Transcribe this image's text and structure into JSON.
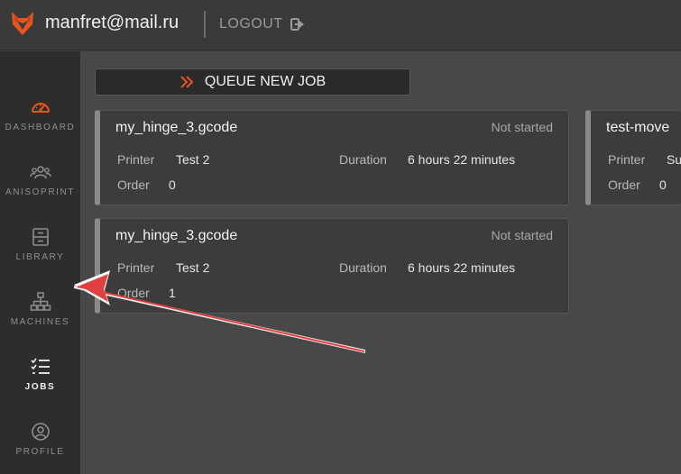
{
  "header": {
    "user": "manfret@mail.ru",
    "logout_label": "LOGOUT",
    "logo_icon": "fox-logo-icon",
    "accent_color": "#e8531f"
  },
  "sidebar": {
    "items": [
      {
        "label": "DASHBOARD",
        "icon": "speedometer-icon",
        "active": false
      },
      {
        "label": "ANISOPRINT",
        "icon": "users-group-icon",
        "active": false
      },
      {
        "label": "LIBRARY",
        "icon": "archive-icon",
        "active": false
      },
      {
        "label": "MACHINES",
        "icon": "network-tree-icon",
        "active": false
      },
      {
        "label": "JOBS",
        "icon": "checklist-icon",
        "active": true
      },
      {
        "label": "PROFILE",
        "icon": "user-circle-icon",
        "active": false
      }
    ]
  },
  "main": {
    "queue_button_label": "QUEUE NEW JOB",
    "jobs": [
      {
        "title": "my_hinge_3.gcode",
        "status": "Not started",
        "printer_label": "Printer",
        "printer": "Test 2",
        "duration_label": "Duration",
        "duration": "6 hours 22 minutes",
        "order_label": "Order",
        "order": "0"
      },
      {
        "title": "test-move",
        "status": "",
        "printer_label": "Printer",
        "printer": "Su",
        "duration_label": "",
        "duration": "",
        "order_label": "Order",
        "order": "0"
      },
      {
        "title": "my_hinge_3.gcode",
        "status": "Not started",
        "printer_label": "Printer",
        "printer": "Test 2",
        "duration_label": "Duration",
        "duration": "6 hours 22 minutes",
        "order_label": "Order",
        "order": "1"
      }
    ]
  }
}
